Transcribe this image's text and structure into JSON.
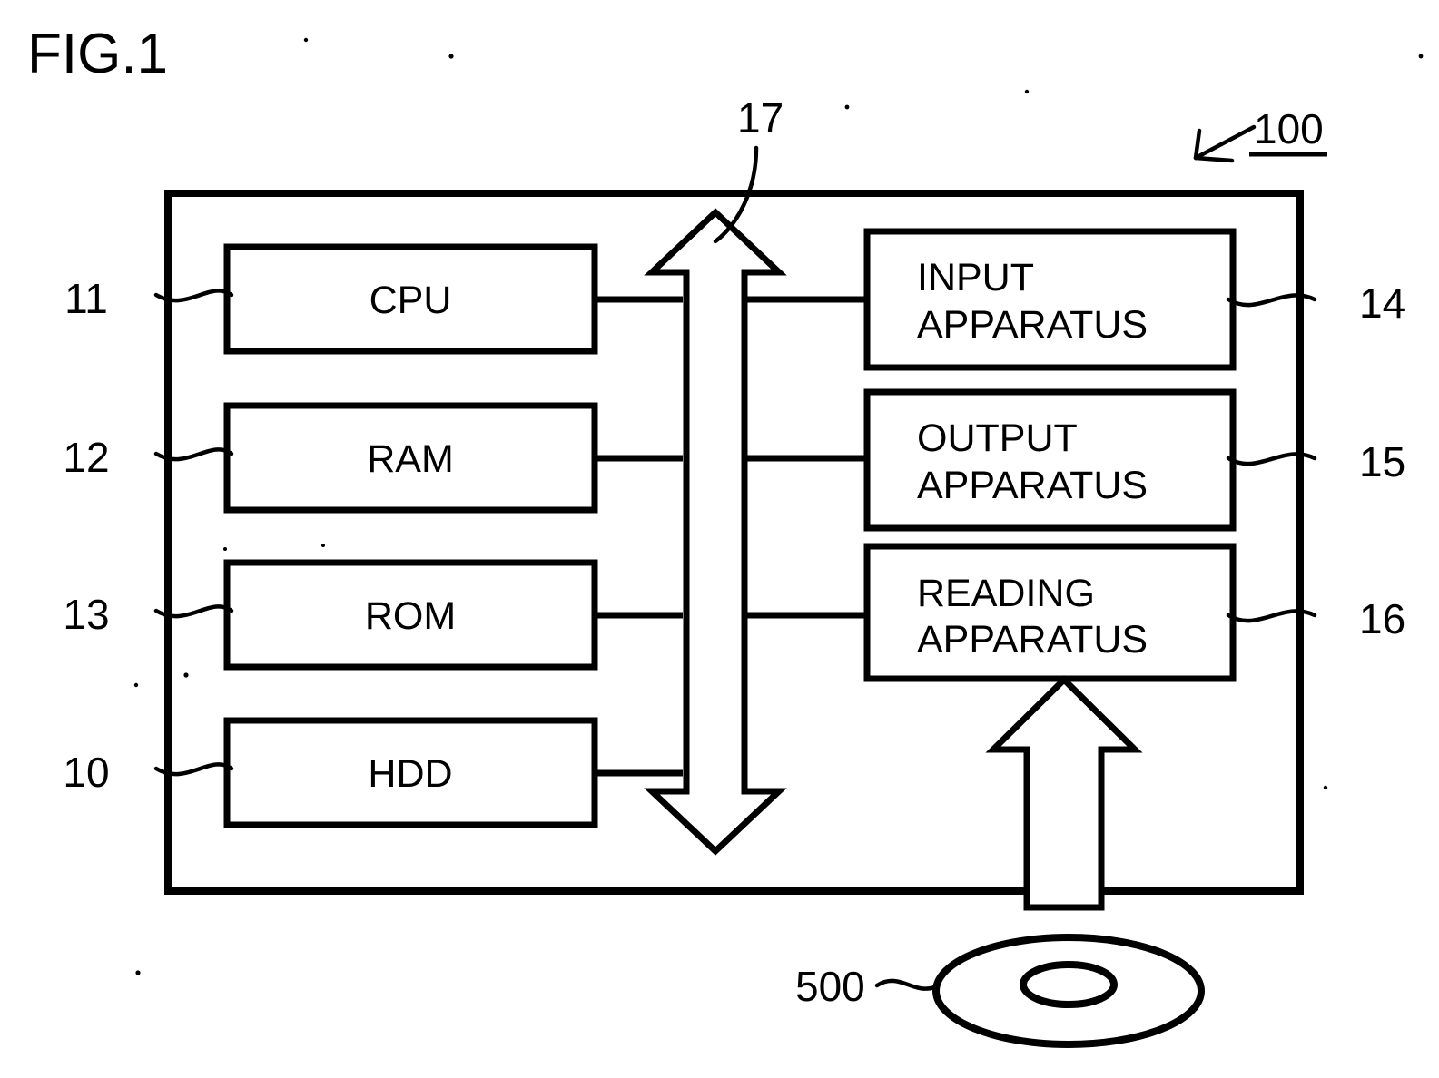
{
  "figure": {
    "title": "FIG.1",
    "type": "patent-block-diagram",
    "description": "Hardware configuration block diagram of an information processing apparatus"
  },
  "system": {
    "reference_numeral": "100",
    "bus": {
      "reference_numeral": "17",
      "icon": "double-headed-vertical-arrow"
    }
  },
  "left_blocks": [
    {
      "label": "CPU",
      "reference_numeral": "11"
    },
    {
      "label": "RAM",
      "reference_numeral": "12"
    },
    {
      "label": "ROM",
      "reference_numeral": "13"
    },
    {
      "label": "HDD",
      "reference_numeral": "10"
    }
  ],
  "right_blocks": [
    {
      "label_line1": "INPUT",
      "label_line2": "APPARATUS",
      "reference_numeral": "14"
    },
    {
      "label_line1": "OUTPUT",
      "label_line2": "APPARATUS",
      "reference_numeral": "15"
    },
    {
      "label_line1": "READING",
      "label_line2": "APPARATUS",
      "reference_numeral": "16"
    }
  ],
  "media": {
    "reference_numeral": "500",
    "icon": "optical-disc-icon",
    "feed_arrow_icon": "up-arrow-icon"
  },
  "colors": {
    "ink": "#000000",
    "paper": "#ffffff"
  }
}
